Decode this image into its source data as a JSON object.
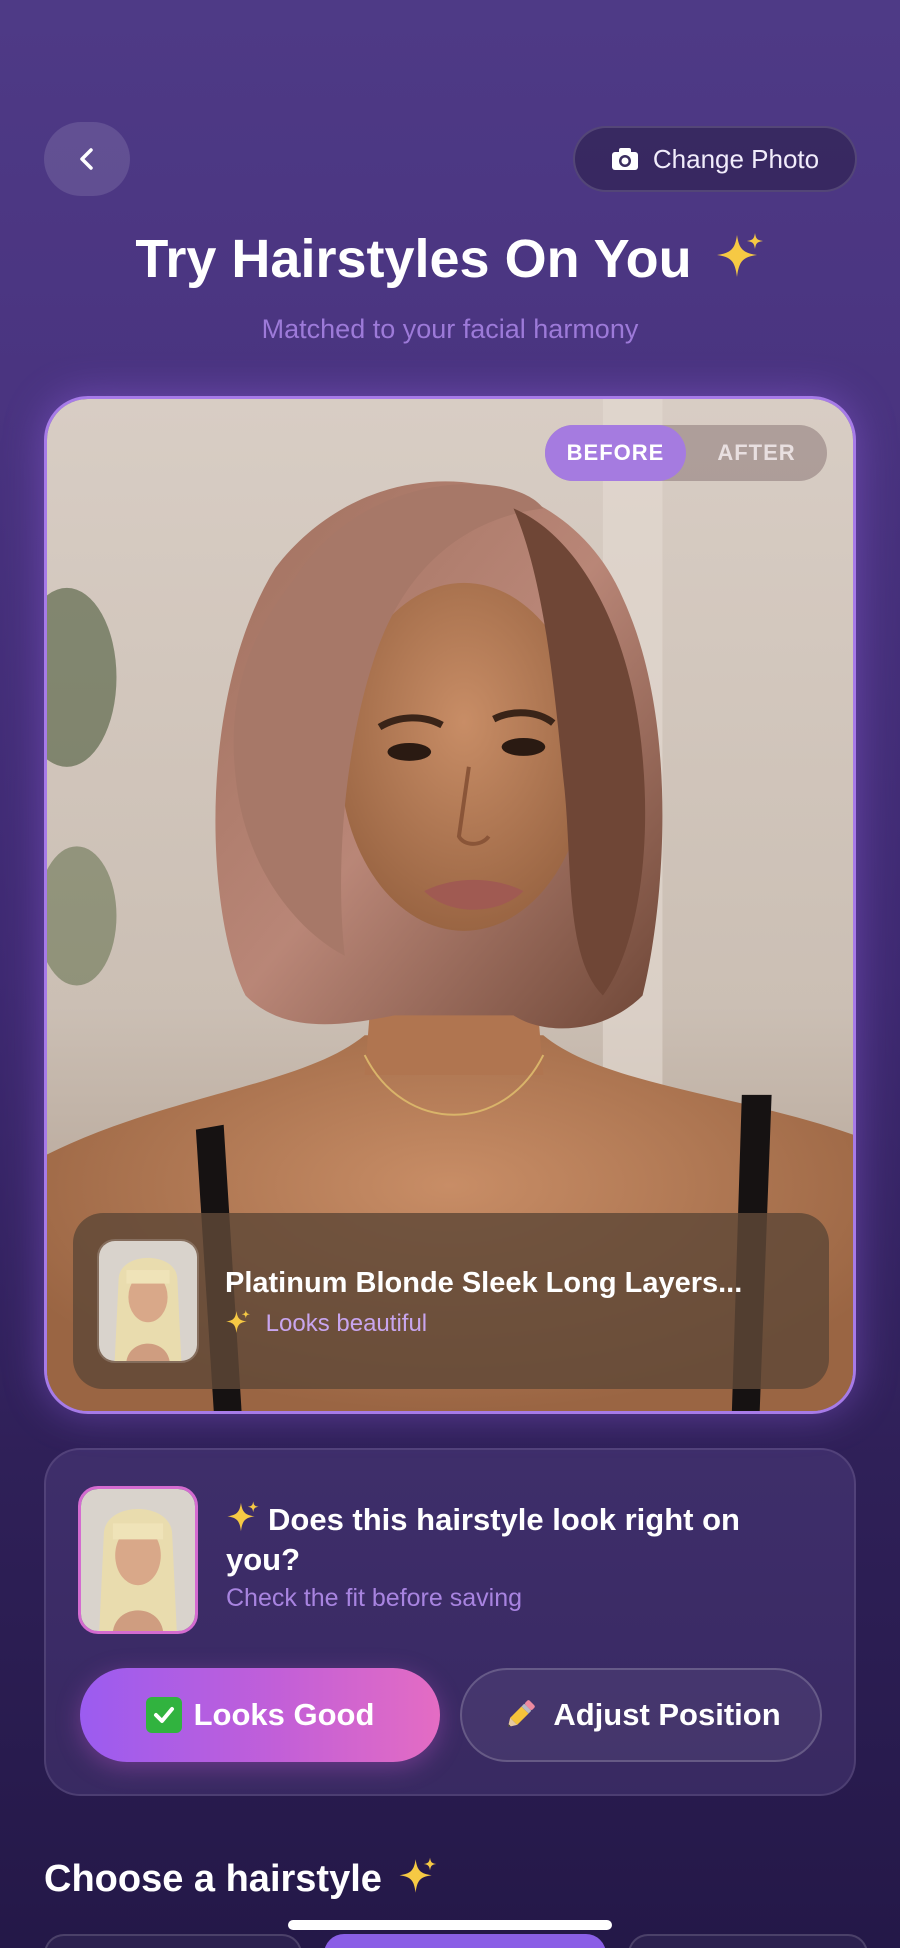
{
  "header": {
    "back_label": "",
    "change_photo_label": "Change Photo",
    "title": "Try Hairstyles On You",
    "subtitle": "Matched to your facial harmony"
  },
  "preview": {
    "toggle": {
      "before": "BEFORE",
      "after": "AFTER",
      "selected": "BEFORE"
    },
    "style_name": "Platinum Blonde Sleek Long Layers...",
    "style_note": "Looks beautiful"
  },
  "fit_check": {
    "question": "Does this hairstyle look right on you?",
    "hint": "Check the fit before saving",
    "looks_good_label": "Looks Good",
    "adjust_label": "Adjust Position"
  },
  "styles_section": {
    "title": "Choose a hairstyle"
  },
  "icons": {
    "back": "chevron-left-icon",
    "camera": "camera-icon",
    "sparkles": "sparkles-icon",
    "check": "check-mark-button-icon",
    "pencil": "pencil-icon"
  },
  "colors": {
    "accent_purple": "#a57be0",
    "subtitle_purple": "#9d7ad9",
    "gradient_start": "#9b5cf0",
    "gradient_end": "#e46cc3"
  }
}
